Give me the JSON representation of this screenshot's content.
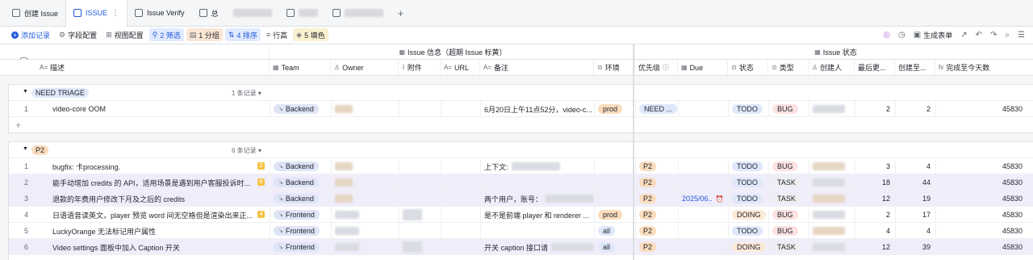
{
  "tabs": [
    {
      "label": "创建 Issue"
    },
    {
      "label": "ISSUE",
      "active": true
    },
    {
      "label": "Issue Verify"
    },
    {
      "label": "总"
    }
  ],
  "toolbar": {
    "add": "添加记录",
    "fields": "字段配置",
    "views": "视图配置",
    "filter": "2 筛选",
    "group": "1 分组",
    "sort": "4 排序",
    "rowheight": "行高",
    "fill": "5 填色",
    "gen_form": "生成表单"
  },
  "header": {
    "group_issue_info": "Issue 信息（超期 Issue 标黄）",
    "group_issue_status": "Issue 状态",
    "columns": {
      "desc": "描述",
      "team": "Team",
      "owner": "Owner",
      "attach": "附件",
      "url": "URL",
      "note": "备注",
      "env": "环境",
      "priority": "优先级",
      "due": "Due",
      "status": "状态",
      "type": "类型",
      "creator": "创建人",
      "last_update": "最后更...",
      "created_days": "创建至...",
      "done_days": "完成至今天数"
    }
  },
  "sections": [
    {
      "tag": "NEED TRIAGE",
      "tag_color": "#dfe8fb",
      "count": "1 条记录",
      "rows": [
        {
          "n": "1",
          "desc": "video-core OOM",
          "team": "Backend",
          "note": "6月20日上午11点52分，video-c...",
          "env": "prod",
          "priority": "NEED ...",
          "due": "",
          "status": "TODO",
          "type": "BUG",
          "last": "2",
          "created": "2",
          "done": "45830"
        }
      ]
    },
    {
      "tag": "P2",
      "tag_color": "#fadcbd",
      "count": "6 条记录",
      "rows": [
        {
          "n": "1",
          "desc": "bugfix: 卡processing.",
          "badge": "2",
          "team": "Backend",
          "note": "上下文:",
          "env": "",
          "priority": "P2",
          "due": "",
          "status": "TODO",
          "type": "BUG",
          "last": "3",
          "created": "4",
          "done": "45830"
        },
        {
          "n": "2",
          "desc": "能手动增加 credits 的 API，适用场景是遇到用户客服投诉时...",
          "badge": "8",
          "team": "Backend",
          "note": "",
          "env": "",
          "priority": "P2",
          "due": "",
          "status": "TODO",
          "type": "TASK",
          "last": "18",
          "created": "44",
          "done": "45830",
          "hl": true
        },
        {
          "n": "3",
          "desc": "退款的年费用户修改下月及之后的 credits",
          "team": "Backend",
          "note": "两个用户，账号：",
          "env": "",
          "priority": "P2",
          "due": "2025/06..",
          "status": "TODO",
          "type": "TASK",
          "last": "12",
          "created": "19",
          "done": "45830",
          "hl": true
        },
        {
          "n": "4",
          "desc": "日语语音读英文，player 预览 word 间无空格但是渲染出来正...",
          "badge": "4",
          "team": "Frontend",
          "note": "是不是前端 player 和 renderer ...",
          "env": "prod",
          "priority": "P2",
          "due": "",
          "status": "DOING",
          "type": "BUG",
          "last": "2",
          "created": "17",
          "done": "45830"
        },
        {
          "n": "5",
          "desc": "LuckyOrange 无法标记用户属性",
          "team": "Frontend",
          "note": "",
          "env": "all",
          "priority": "P2",
          "due": "",
          "status": "TODO",
          "type": "BUG",
          "last": "4",
          "created": "4",
          "done": "45830"
        },
        {
          "n": "6",
          "desc": "Video settings 面板中加入 Caption 开关",
          "team": "Frontend",
          "note": "开关 caption 接口请",
          "env": "all",
          "priority": "P2",
          "due": "",
          "status": "DOING",
          "type": "TASK",
          "last": "12",
          "created": "39",
          "done": "45830",
          "hl": true
        }
      ]
    }
  ]
}
